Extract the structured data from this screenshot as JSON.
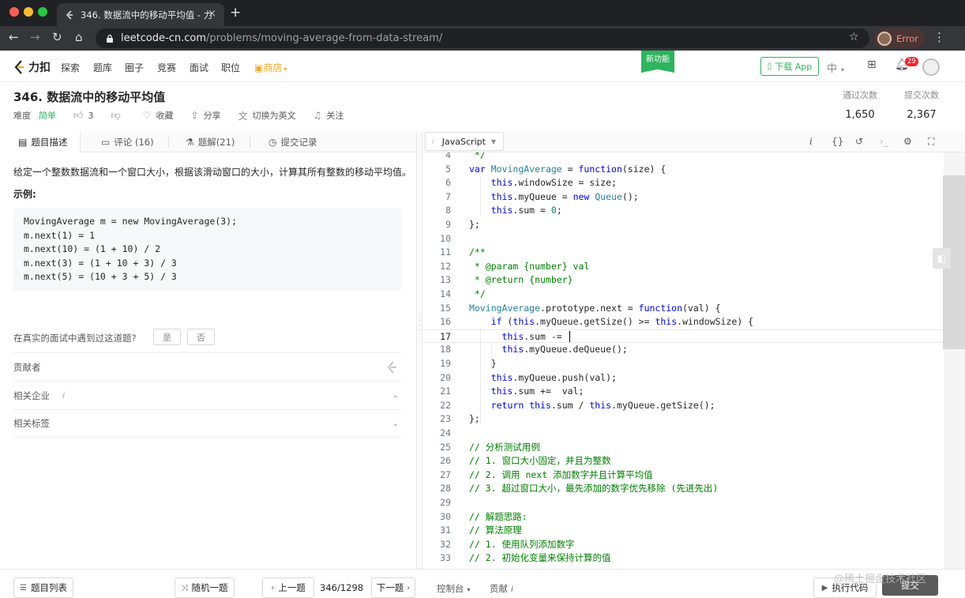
{
  "browser": {
    "tab_title": "346. 数据流中的移动平均值 - 力",
    "url_host": "leetcode-cn.com",
    "url_path": "/problems/moving-average-from-data-stream/",
    "profile_status": "Error",
    "colors": {
      "traffic_red": "#ff5f57",
      "traffic_yellow": "#febc2e",
      "traffic_green": "#28c840"
    }
  },
  "nav": {
    "logo_text": "力扣",
    "links": [
      "探索",
      "题库",
      "圈子",
      "竞赛",
      "面试",
      "职位"
    ],
    "store": "商店",
    "new_feature": "新功能",
    "download_app": "下载 App",
    "language": "中",
    "notification_count": "29",
    "brand_color": "#2db55d"
  },
  "question": {
    "title": "346. 数据流中的移动平均值",
    "difficulty_label": "难度",
    "difficulty": "简单",
    "likes": "3",
    "actions": [
      "收藏",
      "分享",
      "切换为英文",
      "关注"
    ],
    "passed_label": "通过次数",
    "passed": "1,650",
    "submitted_label": "提交次数",
    "submitted": "2,367"
  },
  "left_tabs": [
    "题目描述",
    "评论 (16)",
    "题解(21)",
    "提交记录"
  ],
  "description": {
    "text": "给定一个整数数据流和一个窗口大小，根据该滑动窗口的大小，计算其所有整数的移动平均值。",
    "example_label": "示例:",
    "example_code": [
      "MovingAverage m = new MovingAverage(3);",
      "m.next(1) = 1",
      "m.next(10) = (1 + 10) / 2",
      "m.next(3) = (1 + 10 + 3) / 3",
      "m.next(5) = (10 + 3 + 5) / 3"
    ],
    "interview_question": "在真实的面试中遇到过这道题?",
    "yes": "是",
    "no": "否",
    "contributors": "贡献者",
    "related_companies": "相关企业",
    "related_info": "i",
    "related_tags": "相关标签"
  },
  "editor": {
    "language": "JavaScript",
    "lang_icon": "i",
    "lines": [
      {
        "n": "4",
        "segs": [
          [
            " */",
            "c"
          ]
        ]
      },
      {
        "n": "5",
        "segs": [
          [
            "var ",
            "k"
          ],
          [
            "MovingAverage",
            "t"
          ],
          [
            " = ",
            "p"
          ],
          [
            "function",
            "k"
          ],
          [
            "(size) {",
            "p"
          ]
        ]
      },
      {
        "n": "6",
        "segs": [
          [
            "    ",
            "p"
          ],
          [
            "this",
            "k"
          ],
          [
            ".windowSize = size;",
            "p"
          ]
        ]
      },
      {
        "n": "7",
        "segs": [
          [
            "    ",
            "p"
          ],
          [
            "this",
            "k"
          ],
          [
            ".myQueue = ",
            "p"
          ],
          [
            "new",
            "k"
          ],
          [
            " ",
            "p"
          ],
          [
            "Queue",
            "t"
          ],
          [
            "();",
            "p"
          ]
        ]
      },
      {
        "n": "8",
        "segs": [
          [
            "    ",
            "p"
          ],
          [
            "this",
            "k"
          ],
          [
            ".sum = ",
            "p"
          ],
          [
            "0",
            "n"
          ],
          [
            ";",
            "p"
          ]
        ]
      },
      {
        "n": "9",
        "segs": [
          [
            "};",
            "p"
          ]
        ]
      },
      {
        "n": "10",
        "segs": []
      },
      {
        "n": "11",
        "segs": [
          [
            "/**",
            "c"
          ]
        ]
      },
      {
        "n": "12",
        "segs": [
          [
            " * @param {number} val",
            "c"
          ]
        ]
      },
      {
        "n": "13",
        "segs": [
          [
            " * @return {number}",
            "c"
          ]
        ]
      },
      {
        "n": "14",
        "segs": [
          [
            " */",
            "c"
          ]
        ]
      },
      {
        "n": "15",
        "segs": [
          [
            "MovingAverage",
            "t"
          ],
          [
            ".prototype.next = ",
            "p"
          ],
          [
            "function",
            "k"
          ],
          [
            "(val) {",
            "p"
          ]
        ]
      },
      {
        "n": "16",
        "segs": [
          [
            "    ",
            "p"
          ],
          [
            "if",
            "k"
          ],
          [
            " (",
            "p"
          ],
          [
            "this",
            "k"
          ],
          [
            ".myQueue.getSize() >= ",
            "p"
          ],
          [
            "this",
            "k"
          ],
          [
            ".windowSize) {",
            "p"
          ]
        ]
      },
      {
        "n": "17",
        "segs": [
          [
            "      ",
            "p"
          ],
          [
            "this",
            "k"
          ],
          [
            ".sum -= ",
            "p"
          ]
        ],
        "cursor": true
      },
      {
        "n": "18",
        "segs": [
          [
            "      ",
            "p"
          ],
          [
            "this",
            "k"
          ],
          [
            ".myQueue.deQueue();",
            "p"
          ]
        ]
      },
      {
        "n": "19",
        "segs": [
          [
            "    }",
            "p"
          ]
        ]
      },
      {
        "n": "20",
        "segs": [
          [
            "    ",
            "p"
          ],
          [
            "this",
            "k"
          ],
          [
            ".myQueue.push(val);",
            "p"
          ]
        ]
      },
      {
        "n": "21",
        "segs": [
          [
            "    ",
            "p"
          ],
          [
            "this",
            "k"
          ],
          [
            ".sum +=  val;",
            "p"
          ]
        ]
      },
      {
        "n": "22",
        "segs": [
          [
            "    ",
            "p"
          ],
          [
            "return",
            "k"
          ],
          [
            " ",
            "p"
          ],
          [
            "this",
            "k"
          ],
          [
            ".sum / ",
            "p"
          ],
          [
            "this",
            "k"
          ],
          [
            ".myQueue.getSize();",
            "p"
          ]
        ]
      },
      {
        "n": "23",
        "segs": [
          [
            "};",
            "p"
          ]
        ]
      },
      {
        "n": "24",
        "segs": []
      },
      {
        "n": "25",
        "segs": [
          [
            "// 分析测试用例",
            "c"
          ]
        ]
      },
      {
        "n": "26",
        "segs": [
          [
            "// 1. 窗口大小固定，并且为整数",
            "c"
          ]
        ]
      },
      {
        "n": "27",
        "segs": [
          [
            "// 2. 调用 next 添加数字并且计算平均值",
            "c"
          ]
        ]
      },
      {
        "n": "28",
        "segs": [
          [
            "// 3. 超过窗口大小，最先添加的数字优先移除 (先进先出)",
            "c"
          ]
        ]
      },
      {
        "n": "29",
        "segs": []
      },
      {
        "n": "30",
        "segs": [
          [
            "// 解题思路:",
            "c"
          ]
        ]
      },
      {
        "n": "31",
        "segs": [
          [
            "// 算法原理",
            "c"
          ]
        ]
      },
      {
        "n": "32",
        "segs": [
          [
            "// 1. 使用队列添加数字",
            "c"
          ]
        ]
      },
      {
        "n": "33",
        "segs": [
          [
            "// 2. 初始化变量来保持计算的值",
            "c"
          ]
        ]
      }
    ]
  },
  "footer": {
    "problem_list": "题目列表",
    "random": "随机一题",
    "prev": "上一题",
    "position": "346/1298",
    "next": "下一题",
    "console": "控制台",
    "contribute": "贡献",
    "contribute_info": "i",
    "run": "执行代码",
    "submit": "提交",
    "watermark": "@稀土掘金技术社区"
  }
}
